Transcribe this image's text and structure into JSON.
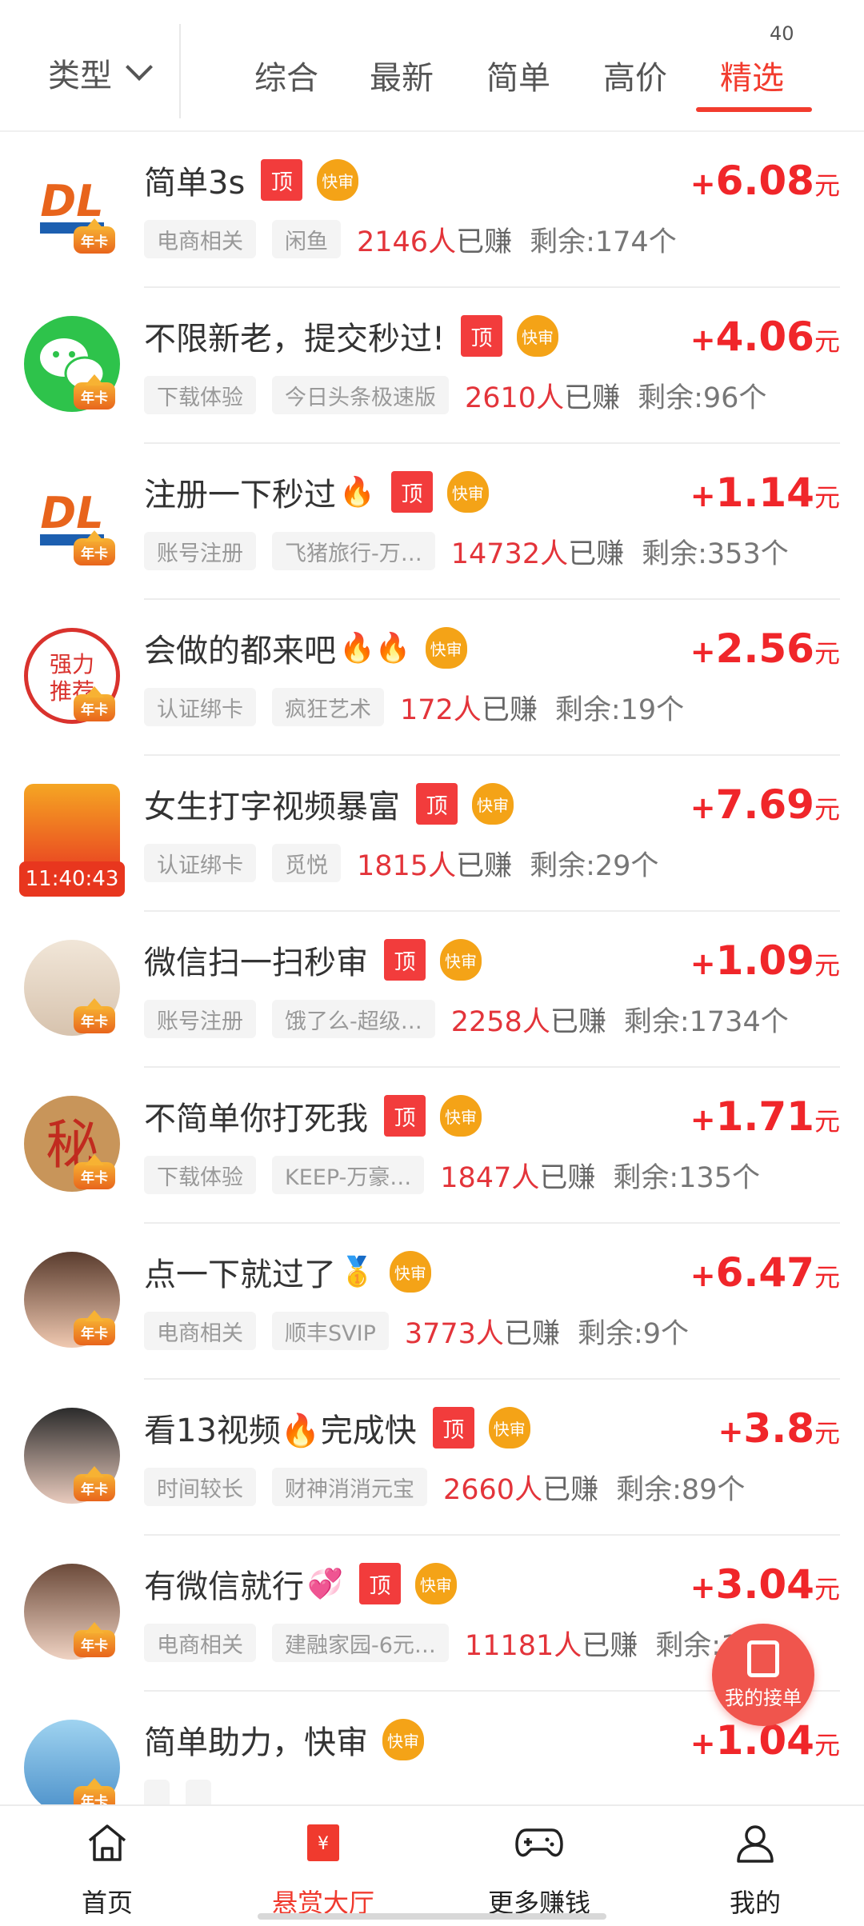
{
  "header": {
    "type_filter": "类型",
    "tabs": [
      "综合",
      "最新",
      "简单",
      "高价",
      "精选"
    ],
    "active_tab": "精选",
    "active_tab_count": "40"
  },
  "badges": {
    "ding": "顶",
    "kuaishen": "快审",
    "nianka": "年卡",
    "earned_suffix": "已赚",
    "yuan": "元"
  },
  "tasks": [
    {
      "title": "简单3s",
      "emoji": "",
      "ding": true,
      "kuaishen": true,
      "reward": "6.08",
      "tags": [
        "电商相关",
        "闲鱼"
      ],
      "earned": "2146人",
      "remain": "剩余:174个",
      "avatar": "dl-logo"
    },
    {
      "title": "不限新老，提交秒过!",
      "emoji": "",
      "ding": true,
      "kuaishen": true,
      "reward": "4.06",
      "tags": [
        "下载体验",
        "今日头条极速版"
      ],
      "earned": "2610人",
      "remain": "剩余:96个",
      "avatar": "wechat-logo"
    },
    {
      "title": "注册一下秒过",
      "emoji": "🔥",
      "ding": true,
      "kuaishen": true,
      "reward": "1.14",
      "tags": [
        "账号注册",
        "飞猪旅行-万…"
      ],
      "earned": "14732人",
      "remain": "剩余:353个",
      "avatar": "dl-logo"
    },
    {
      "title": "会做的都来吧",
      "emoji": "🔥🔥",
      "ding": false,
      "kuaishen": true,
      "reward": "2.56",
      "tags": [
        "认证绑卡",
        "疯狂艺术"
      ],
      "earned": "172人",
      "remain": "剩余:19个",
      "avatar": "stamp"
    },
    {
      "title": "女生打字视频暴富",
      "emoji": "",
      "ding": true,
      "kuaishen": true,
      "reward": "7.69",
      "tags": [
        "认证绑卡",
        "觅悦"
      ],
      "earned": "1815人",
      "remain": "剩余:29个",
      "avatar": "redpacket",
      "timer": "11:40:43"
    },
    {
      "title": "微信扫一扫秒审",
      "emoji": "",
      "ding": true,
      "kuaishen": true,
      "reward": "1.09",
      "tags": [
        "账号注册",
        "饿了么-超级…"
      ],
      "earned": "2258人",
      "remain": "剩余:1734个",
      "avatar": "baby"
    },
    {
      "title": "不简单你打死我",
      "emoji": "",
      "ding": true,
      "kuaishen": true,
      "reward": "1.71",
      "tags": [
        "下载体验",
        "KEEP-万豪…"
      ],
      "earned": "1847人",
      "remain": "剩余:135个",
      "avatar": "mi"
    },
    {
      "title": "点一下就过了",
      "emoji": "🥇",
      "ding": false,
      "kuaishen": true,
      "reward": "6.47",
      "tags": [
        "电商相关",
        "顺丰SVIP"
      ],
      "earned": "3773人",
      "remain": "剩余:9个",
      "avatar": "girl1"
    },
    {
      "title": "看13视频🔥完成快",
      "emoji": "",
      "ding": true,
      "kuaishen": true,
      "reward": "3.8",
      "tags": [
        "时间较长",
        "财神消消元宝"
      ],
      "earned": "2660人",
      "remain": "剩余:89个",
      "avatar": "girl2"
    },
    {
      "title": "有微信就行",
      "emoji": "💞",
      "ding": true,
      "kuaishen": true,
      "reward": "3.04",
      "tags": [
        "电商相关",
        "建融家园-6元…"
      ],
      "earned": "11181人",
      "remain": "剩余:17个",
      "avatar": "girl3"
    },
    {
      "title": "简单助力，快审",
      "emoji": "",
      "ding": false,
      "kuaishen": true,
      "reward": "1.04",
      "tags": [
        "",
        ""
      ],
      "earned": "",
      "remain": "",
      "avatar": "boy"
    }
  ],
  "fab": {
    "label": "我的接单"
  },
  "bottom_nav": [
    {
      "label": "首页",
      "icon": "home-icon"
    },
    {
      "label": "悬赏大厅",
      "icon": "reward-hall-icon"
    },
    {
      "label": "更多赚钱",
      "icon": "gamepad-icon"
    },
    {
      "label": "我的",
      "icon": "user-icon"
    }
  ],
  "colors": {
    "accent": "#f23c2e",
    "reward": "#f0262a",
    "kuaishen": "#f4a317"
  }
}
